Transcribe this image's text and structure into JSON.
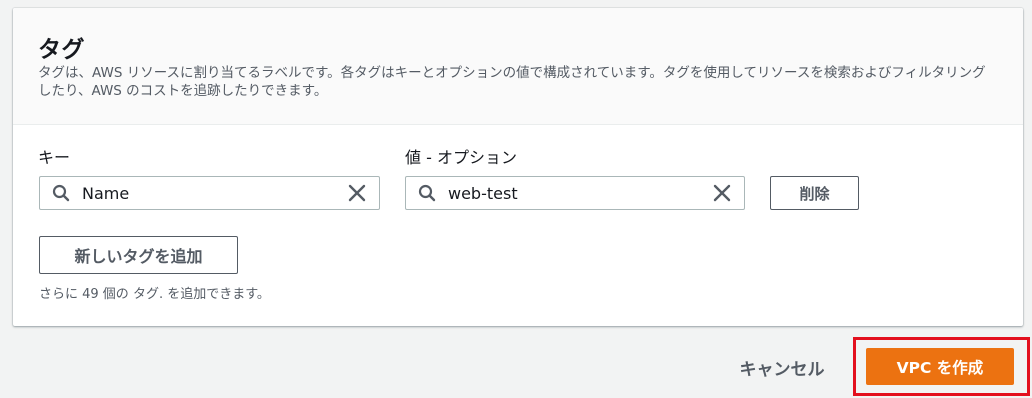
{
  "tags_panel": {
    "title": "タグ",
    "description": "タグは、AWS リソースに割り当てるラベルです。各タグはキーとオプションの値で構成されています。タグを使用してリソースを検索およびフィルタリングしたり、AWS のコストを追跡したりできます。",
    "key_label": "キー",
    "value_label": "値 - オプション",
    "rows": [
      {
        "key": "Name",
        "value": "web-test",
        "remove_label": "削除"
      }
    ],
    "add_tag_label": "新しいタグを追加",
    "remaining_hint": "さらに 49 個の タグ. を追加できます。"
  },
  "footer": {
    "cancel_label": "キャンセル",
    "create_label": "VPC を作成"
  },
  "colors": {
    "primary": "#ec7211",
    "highlight": "#e3101e"
  },
  "icons": {
    "search": "search-icon",
    "clear": "close-icon"
  }
}
